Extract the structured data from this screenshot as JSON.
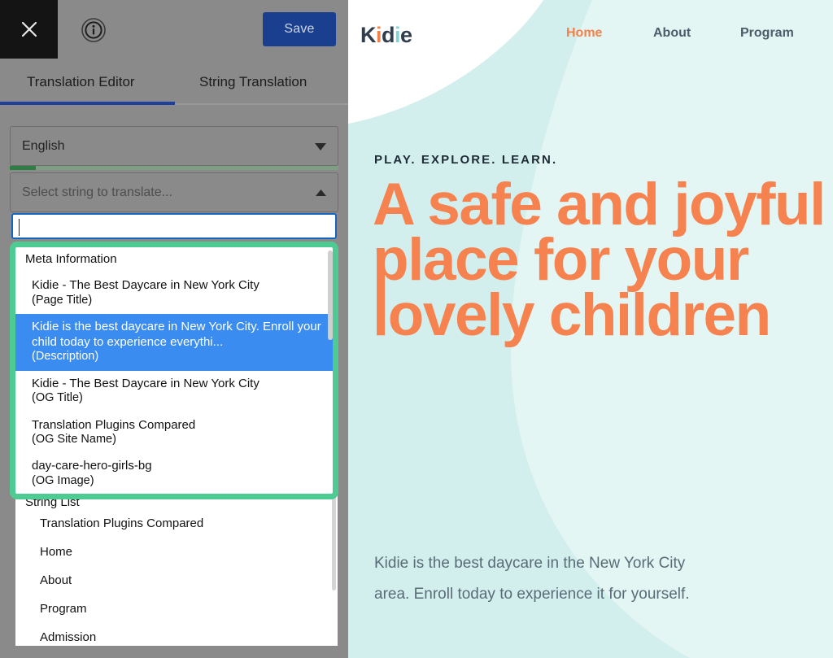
{
  "editor": {
    "close_icon": "close-x-icon",
    "info_icon": "info-circle-icon",
    "save_label": "Save",
    "tabs": [
      {
        "label": "Translation Editor",
        "active": true
      },
      {
        "label": "String Translation",
        "active": false
      }
    ],
    "language_select": {
      "value": "English",
      "caret_icon": "chevron-down-icon",
      "progress_percent": 8
    },
    "string_select": {
      "placeholder": "Select string to translate...",
      "caret_icon": "chevron-up-icon"
    },
    "search": {
      "value": "",
      "placeholder": ""
    },
    "dropdown": {
      "group_label": "Meta Information",
      "items": [
        {
          "main": "Kidie - The Best Daycare in New York City",
          "sub": "(Page Title)",
          "selected": false
        },
        {
          "main": "Kidie is the best daycare in New York City. Enroll your child today to experience everythi...",
          "sub": "(Description)",
          "selected": true
        },
        {
          "main": "Kidie - The Best Daycare in New York City",
          "sub": "(OG Title)",
          "selected": false
        },
        {
          "main": "Translation Plugins Compared",
          "sub": "(OG Site Name)",
          "selected": false
        },
        {
          "main": "day-care-hero-girls-bg",
          "sub": "(OG Image)",
          "selected": false
        }
      ]
    },
    "string_list": {
      "title": "String List",
      "items": [
        "Translation Plugins Compared",
        "Home",
        "About",
        "Program",
        "Admission"
      ]
    },
    "colors": {
      "save_button": "#1a3f8f",
      "active_tab_underline": "#1f3f9e",
      "highlight_ring": "#4ecb93",
      "selected_row": "#3b8cf0",
      "progress_fill": "#2e7d42",
      "panel_background": "#8a8a8a"
    }
  },
  "preview": {
    "logo": {
      "letters": [
        "K",
        "i",
        "d",
        "i",
        "e"
      ],
      "text": "Kidie"
    },
    "nav": [
      {
        "label": "Home",
        "active": true
      },
      {
        "label": "About",
        "active": false
      },
      {
        "label": "Program",
        "active": false
      }
    ],
    "hero": {
      "eyebrow": "PLAY. EXPLORE. LEARN.",
      "title": "A safe and joyful place for your lovely children",
      "description": "Kidie is the best daycare in the New York City area. Enroll today to experience it for yourself."
    },
    "colors": {
      "accent": "#f5824f",
      "background_teal": "#d5f0ee",
      "background_light_teal": "#e2f5f2",
      "background_white": "#ffffff",
      "body_text": "#5a6b78",
      "logo_dark": "#2f3d4c",
      "logo_teal": "#7fd4d8"
    }
  }
}
